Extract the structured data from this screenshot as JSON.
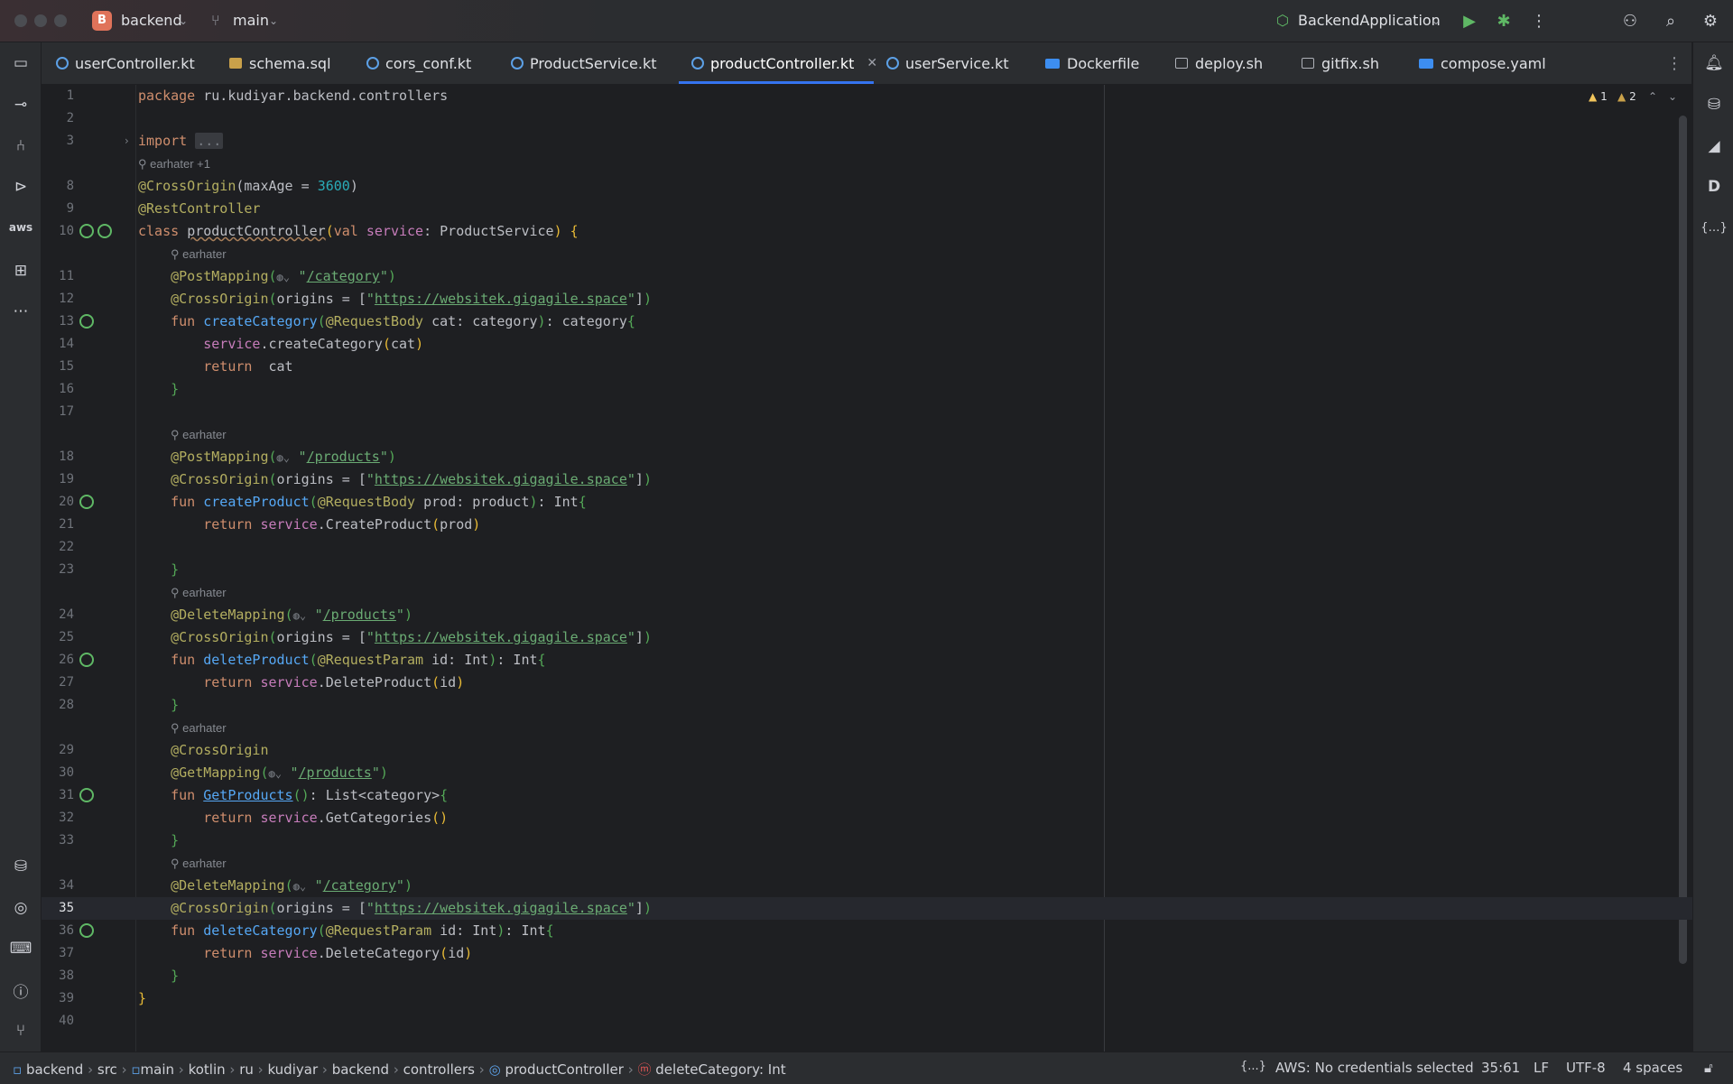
{
  "titlebar": {
    "project_badge": "B",
    "project_name": "backend",
    "branch": "main",
    "run_config": "BackendApplication"
  },
  "tabs": [
    {
      "label": "userController.kt"
    },
    {
      "label": "schema.sql"
    },
    {
      "label": "cors_conf.kt"
    },
    {
      "label": "ProductService.kt"
    },
    {
      "label": "productController.kt",
      "active": true
    },
    {
      "label": "userService.kt"
    },
    {
      "label": "Dockerfile"
    },
    {
      "label": "deploy.sh"
    },
    {
      "label": "gitfix.sh"
    },
    {
      "label": "compose.yaml"
    }
  ],
  "inspections": {
    "warnings": "1",
    "weak_warnings": "2"
  },
  "editor": {
    "line_numbers": [
      "1",
      "2",
      "3",
      "8",
      "9",
      "10",
      "11",
      "12",
      "13",
      "14",
      "15",
      "16",
      "17",
      "18",
      "19",
      "20",
      "21",
      "22",
      "23",
      "24",
      "25",
      "26",
      "27",
      "28",
      "29",
      "30",
      "31",
      "32",
      "33",
      "34",
      "35",
      "36",
      "37",
      "38",
      "39",
      "40"
    ],
    "authors": {
      "a1": "earhater +1",
      "a2": "earhater",
      "a3": "earhater",
      "a4": "earhater",
      "a5": "earhater",
      "a6": "earhater"
    },
    "code": {
      "l1": "package ru.kudiyar.backend.controllers",
      "l3_kw": "import",
      "l3_fold": "...",
      "origin_max": "@CrossOrigin(maxAge = ",
      "origin_max_num": "3600",
      "rest": "@RestController",
      "class_kw": "class ",
      "class_name": "productController",
      "class_params": "(val ",
      "class_prop": "service",
      "class_type": ": ProductService",
      "url": "https://websitek.gigagile.space",
      "path_category": "/category",
      "path_products": "/products",
      "post_mapping": "@PostMapping(",
      "delete_mapping": "@DeleteMapping(",
      "get_mapping": "@GetMapping(",
      "cross_origin_pre": "@CrossOrigin(origins = [",
      "cross_origin_post": "])",
      "cross_origin": "@CrossOrigin",
      "fun_kw": "fun ",
      "return_kw": "return ",
      "service": "service",
      "createCategory": "createCategory",
      "createCategory_sig": "(@RequestBody cat: category): category",
      "createCategory_call": ".createCategory(cat)",
      "return_cat": " cat",
      "createProduct": "createProduct",
      "createProduct_sig": "(@RequestBody prod: product): Int",
      "createProduct_call": ".CreateProduct(prod)",
      "deleteProduct": "deleteProduct",
      "deleteProduct_sig": "(@RequestParam id: Int): Int",
      "deleteProduct_call": ".DeleteProduct(id)",
      "getProducts": "GetProducts",
      "getProducts_sig": "(): List<category>",
      "getProducts_call": ".GetCategories()",
      "deleteCategory": "deleteCategory",
      "deleteCategory_sig": "(@RequestParam id: Int): Int",
      "deleteCategory_call": ".DeleteCategory(id)"
    }
  },
  "breadcrumb": [
    "backend",
    "src",
    "main",
    "kotlin",
    "ru",
    "kudiyar",
    "backend",
    "controllers",
    "productController",
    "deleteCategory: Int"
  ],
  "status": {
    "json_icon": "{...}",
    "aws": "AWS: No credentials selected",
    "position": "35:61",
    "line_sep": "LF",
    "encoding": "UTF-8",
    "indent": "4 spaces"
  }
}
